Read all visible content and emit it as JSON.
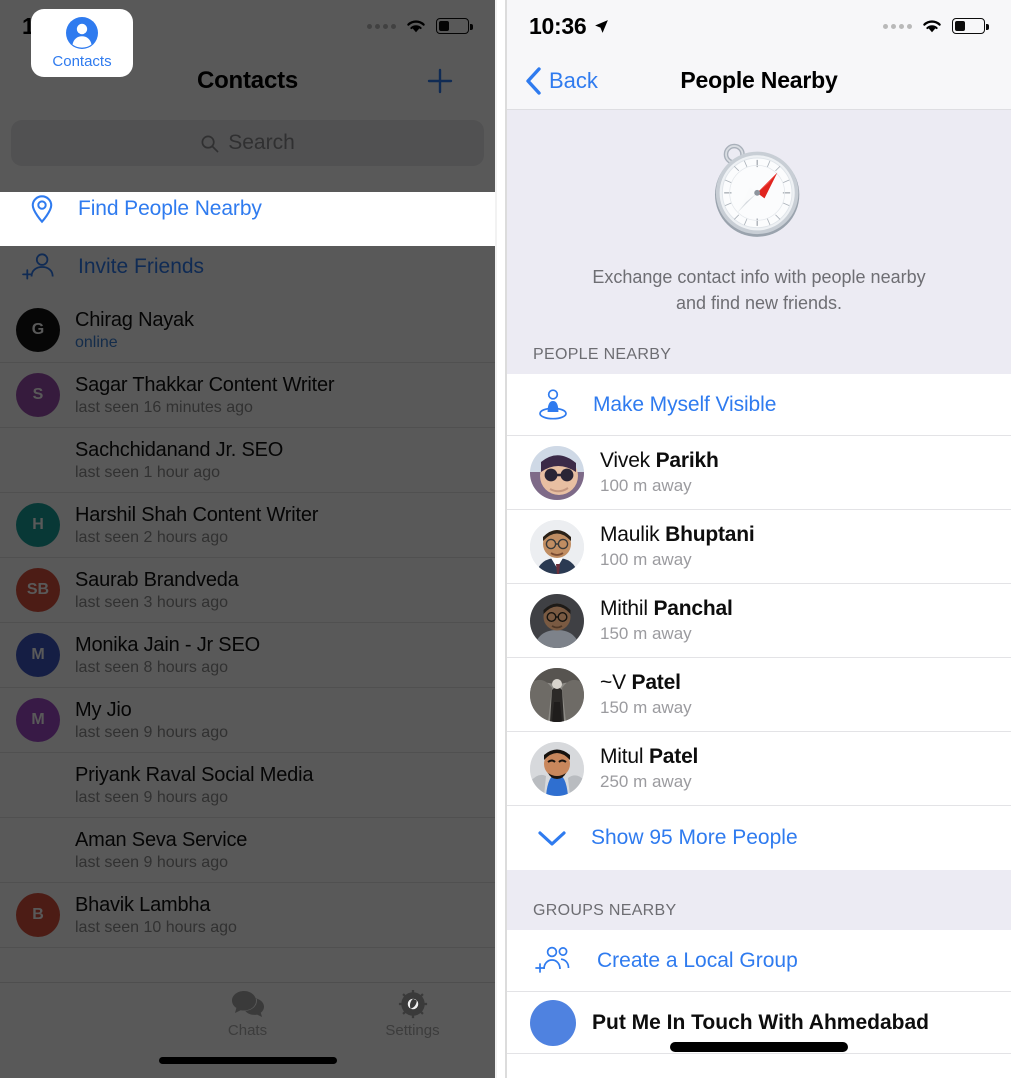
{
  "left": {
    "status": {
      "time": "10:35",
      "location_icon": "location-arrow-icon",
      "wifi_icon": "wifi-icon",
      "battery_icon": "battery-icon"
    },
    "nav": {
      "title": "Contacts",
      "add_icon": "plus-icon"
    },
    "search": {
      "placeholder": "Search",
      "icon": "search-icon"
    },
    "find_people_nearby": {
      "label": "Find People Nearby",
      "icon": "map-pin-icon"
    },
    "invite": {
      "label": "Invite Friends",
      "icon": "person-add-icon"
    },
    "contacts": [
      {
        "name": "Chirag Nayak",
        "status": "online",
        "online": true,
        "initials": "G",
        "color": "#121212"
      },
      {
        "name": "Sagar Thakkar Content Writer",
        "status": "last seen 16 minutes ago",
        "online": false,
        "initials": "S",
        "color": "#9b4fae"
      },
      {
        "name": "Sachchidanand Jr. SEO",
        "status": "last seen 1 hour ago",
        "online": false,
        "initials": "",
        "color": ""
      },
      {
        "name": "Harshil Shah Content Writer",
        "status": "last seen 2 hours ago",
        "online": false,
        "initials": "H",
        "color": "#17a09a"
      },
      {
        "name": "Saurab Brandveda",
        "status": "last seen 3 hours ago",
        "online": false,
        "initials": "SB",
        "color": "#d9503c"
      },
      {
        "name": "Monika Jain - Jr SEO",
        "status": "last seen 8 hours ago",
        "online": false,
        "initials": "M",
        "color": "#3d56c4"
      },
      {
        "name": "My Jio",
        "status": "last seen 9 hours ago",
        "online": false,
        "initials": "M",
        "color": "#a24bc9"
      },
      {
        "name": "Priyank Raval Social Media",
        "status": "last seen 9 hours ago",
        "online": false,
        "initials": "",
        "color": ""
      },
      {
        "name": "Aman Seva Service",
        "status": "last seen 9 hours ago",
        "online": false,
        "initials": "",
        "color": ""
      },
      {
        "name": "Bhavik Lambha",
        "status": "last seen 10 hours ago",
        "online": false,
        "initials": "B",
        "color": "#d9503c"
      }
    ],
    "tabs": [
      {
        "label": "Contacts",
        "icon": "person-circle-icon",
        "active": true
      },
      {
        "label": "Chats",
        "icon": "chat-bubbles-icon",
        "active": false
      },
      {
        "label": "Settings",
        "icon": "gear-icon",
        "active": false
      }
    ]
  },
  "right": {
    "status": {
      "time": "10:36",
      "location_icon": "location-arrow-icon",
      "wifi_icon": "wifi-icon",
      "battery_icon": "battery-icon"
    },
    "nav": {
      "back_label": "Back",
      "back_icon": "chevron-left-icon",
      "title": "People Nearby"
    },
    "hero": {
      "icon": "compass-icon",
      "line1": "Exchange contact info with people nearby",
      "line2": "and find new friends."
    },
    "section_people": {
      "header": "PEOPLE NEARBY"
    },
    "make_visible": {
      "label": "Make Myself Visible",
      "icon": "person-visible-icon"
    },
    "people": [
      {
        "first": "Vivek ",
        "last": "Parikh",
        "distance": "100 m away",
        "avatar": "photo-avatar"
      },
      {
        "first": "Maulik ",
        "last": "Bhuptani",
        "distance": "100 m away",
        "avatar": "photo-avatar"
      },
      {
        "first": "Mithil ",
        "last": "Panchal",
        "distance": "150 m away",
        "avatar": "photo-avatar"
      },
      {
        "first": "~V ",
        "last": "Patel",
        "distance": "150 m away",
        "avatar": "photo-avatar"
      },
      {
        "first": "Mitul ",
        "last": "Patel",
        "distance": "250 m away",
        "avatar": "photo-avatar"
      }
    ],
    "show_more": {
      "label": "Show 95 More People",
      "icon": "chevron-down-icon"
    },
    "section_groups": {
      "header": "GROUPS NEARBY"
    },
    "create_group": {
      "label": "Create a Local Group",
      "icon": "group-add-icon"
    },
    "groups": [
      {
        "name": "Put Me In Touch With Ahmedabad"
      }
    ]
  },
  "colors": {
    "accent_blue": "#2f7bef",
    "section_bg": "#ecebf3",
    "subtitle_gray": "#8c8c8c"
  }
}
